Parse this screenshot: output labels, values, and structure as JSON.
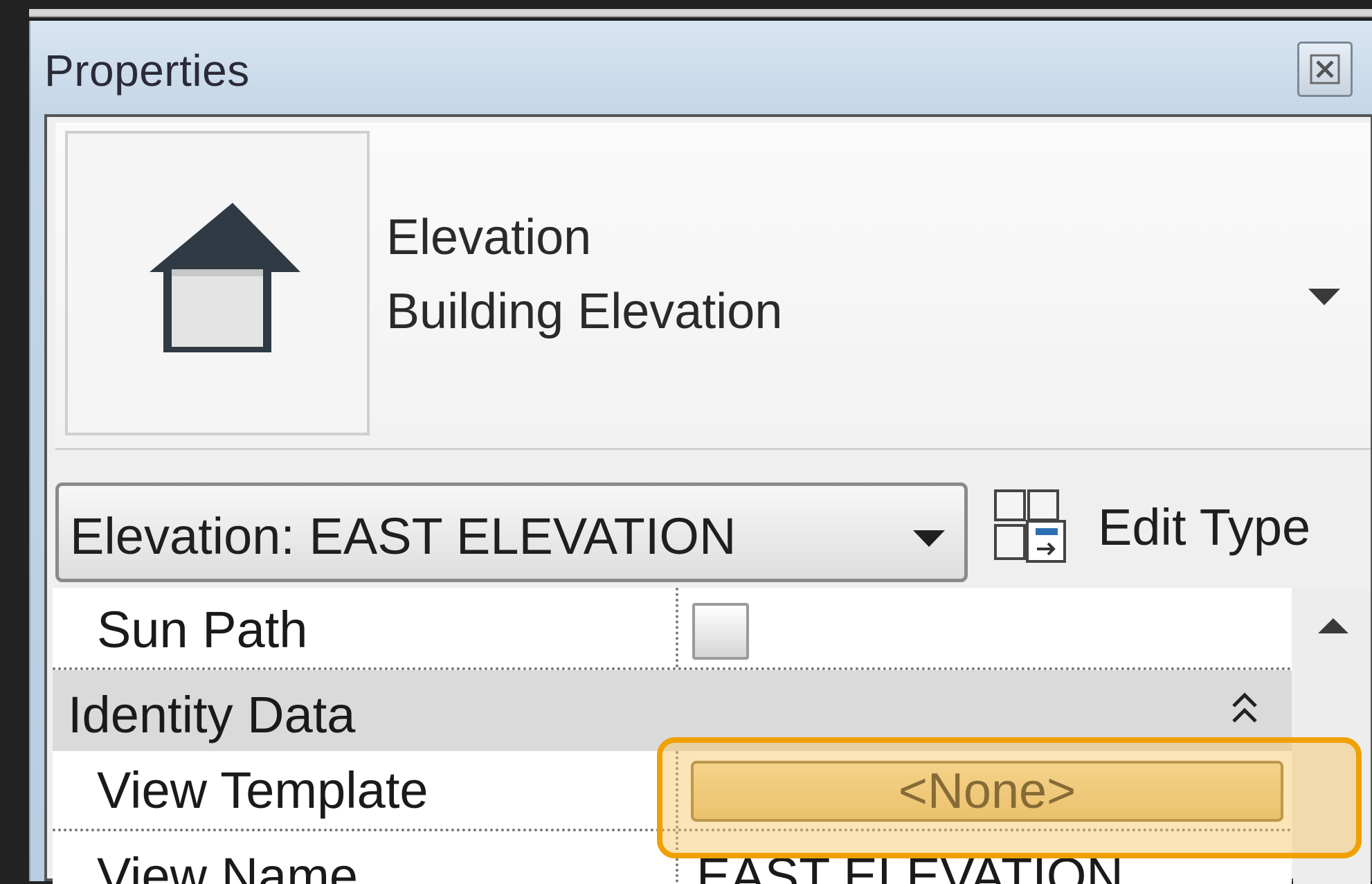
{
  "panel": {
    "title": "Properties"
  },
  "type_selector": {
    "family": "Elevation",
    "type": "Building Elevation"
  },
  "instance": {
    "selector_label": "Elevation: EAST ELEVATION",
    "edit_type_label": "Edit Type"
  },
  "properties": {
    "sun_path": {
      "label": "Sun Path",
      "checked": false
    },
    "group": {
      "label": "Identity Data"
    },
    "view_template": {
      "label": "View Template",
      "value": "<None>"
    },
    "view_name": {
      "label": "View Name",
      "value": "EAST ELEVATION"
    }
  },
  "colors": {
    "highlight": "#f0a000",
    "button_fill": "#e8c98a",
    "header_bg": "#c4d6e8"
  },
  "icons": [
    "close-icon",
    "elevation-arrow-icon",
    "dropdown-caret-icon",
    "edit-type-icon",
    "collapse-chevrons-icon",
    "scroll-up-icon"
  ]
}
